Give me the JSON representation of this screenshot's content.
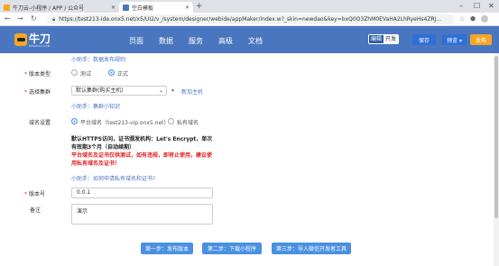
{
  "browser": {
    "tabs": [
      {
        "title": "牛刀云-小程序 / APP / 公众号",
        "favicon_color": "#f5a623"
      },
      {
        "title": "空白模板",
        "favicon_color": "#4a76bf"
      }
    ],
    "new_tab": "+",
    "url": "https://test213-ide.onx5.net/x5/UI2/v_/system/designer/webide/appMaker/index.w?_skin=newdao&key=bxQ0O3ZhM0EVaHA2LhRyeHs4ZRJ..."
  },
  "app": {
    "logo_text": "牛刀",
    "logo_subtext": "NEWDAO.COM",
    "nav": [
      "页面",
      "数据",
      "服务",
      "高级",
      "文档"
    ],
    "mode_toggle": {
      "on": "编辑",
      "off": "开发"
    },
    "buttons": {
      "save": "保存",
      "preview": "预览 ▾",
      "publish": "发布"
    },
    "colors": {
      "header": "#4a76bf",
      "primary": "#4a90e2",
      "publish": "#f5a623",
      "danger": "#e02020"
    }
  },
  "form": {
    "top_hint": "小助手：数据发布规则",
    "version_type": {
      "label": "版本类型",
      "options": [
        {
          "label": "测试",
          "checked": false
        },
        {
          "label": "正式",
          "checked": true
        }
      ]
    },
    "cluster": {
      "label": "选择集群",
      "value": "默认集群(购买主机)",
      "add_link": "新加主机",
      "hint": "小助手：集群小知识"
    },
    "domain": {
      "label": "域名设置",
      "options": [
        {
          "label": "平台域名（test213-vip.onx5.net）",
          "checked": true
        },
        {
          "label": "私有域名",
          "checked": false
        }
      ],
      "info": "默认HTTPS访问，证书颁发机构：Let's Encrypt，单次有效期3个月（自动续期）",
      "warning": "平台域名及证书仅供测试，如有违规，即将止使用，建议使用私有域名及证书！",
      "hint": "小助手：如何申请私有域名和证书?"
    },
    "version_no": {
      "label": "版本号",
      "value": "0.0.1"
    },
    "remark": {
      "label": "备注",
      "value": "演示"
    }
  },
  "steps": [
    "第一步：发布版本",
    "第二步：下载小程序",
    "第三步：导入微信开发者工具"
  ]
}
